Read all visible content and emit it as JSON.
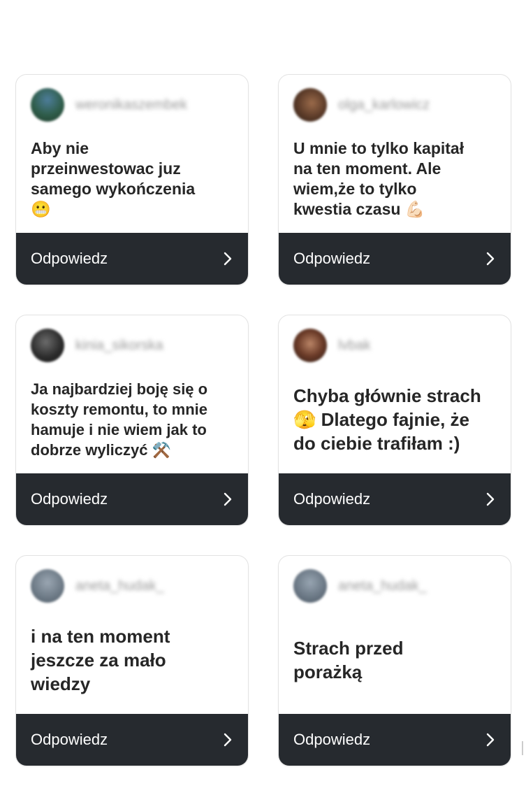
{
  "reply_label": "Odpowiedz",
  "cards": [
    {
      "username": "weronikaszembek",
      "text": "Aby nie\nprzeinwestowac juz\nsamego wykończenia\n😬"
    },
    {
      "username": "olga_karlowicz",
      "text": "U mnie to tylko kapitał\nna ten moment. Ale\nwiem,że to tylko\nkwestia czasu 💪🏻"
    },
    {
      "username": "kinia_sikorska",
      "text": "Ja najbardziej boję się o\nkoszty remontu, to mnie\nhamuje i nie wiem jak to\ndobrze wyliczyć ⚒️"
    },
    {
      "username": "lvbak",
      "text": "Chyba głównie strach\n🫣 Dlatego fajnie, że\ndo ciebie trafiłam :)"
    },
    {
      "username": "aneta_hudak_",
      "text": "i na ten moment\njeszcze za mało\nwiedzy"
    },
    {
      "username": "aneta_hudak_",
      "text": "Strach przed\nporażką"
    }
  ]
}
